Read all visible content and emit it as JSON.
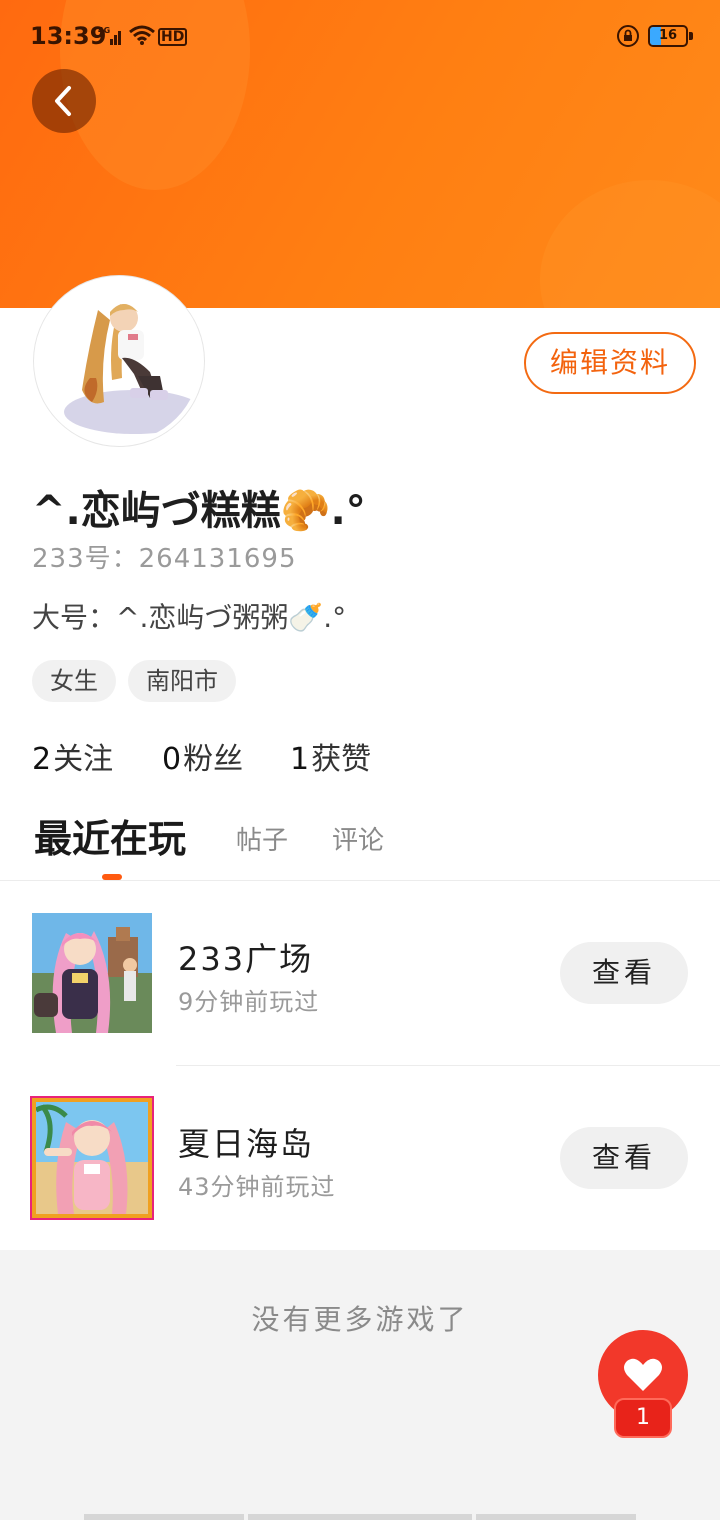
{
  "status_bar": {
    "time": "13:39",
    "network": "4G",
    "hd": "HD",
    "battery": "16"
  },
  "profile": {
    "edit_button": "编辑资料",
    "username": "^.恋屿づ糕糕🥐.°",
    "id_line": "233号：264131695",
    "alt_account": "大号：^.恋屿づ粥粥🍼.°",
    "tags": [
      "女生",
      "南阳市"
    ],
    "stats": {
      "following_count": "2",
      "following_label": "关注",
      "fans_count": "0",
      "fans_label": "粉丝",
      "likes_count": "1",
      "likes_label": "获赞"
    }
  },
  "tabs": {
    "recent": "最近在玩",
    "posts": "帖子",
    "comments": "评论"
  },
  "games": [
    {
      "title": "233广场",
      "played": "9分钟前玩过",
      "button": "查看"
    },
    {
      "title": "夏日海岛",
      "played": "43分钟前玩过",
      "button": "查看"
    }
  ],
  "footer": {
    "no_more": "没有更多游戏了",
    "fab_badge": "1"
  },
  "colors": {
    "accent": "#ff6a10",
    "fab": "#f2382a"
  }
}
